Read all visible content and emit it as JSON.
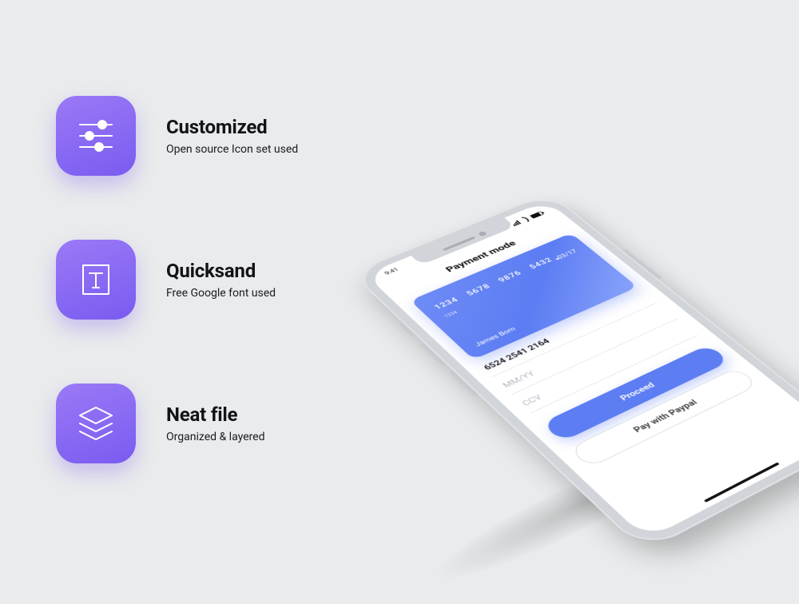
{
  "features": [
    {
      "title": "Customized",
      "subtitle": "Open source Icon set used",
      "icon": "sliders-icon"
    },
    {
      "title": "Quicksand",
      "subtitle": "Free Google font used",
      "icon": "typography-icon"
    },
    {
      "title": "Neat file",
      "subtitle": "Organized & layered",
      "icon": "layers-icon"
    }
  ],
  "phone": {
    "status": {
      "time": "9:41"
    },
    "app_title": "Payment mode",
    "card": {
      "number_groups": [
        "1234",
        "5678",
        "9876",
        "5432"
      ],
      "label": "1234",
      "holder": "James Born",
      "expiry": "03/17"
    },
    "fields": {
      "card_number_value": "6524 2541 2164",
      "expiry_placeholder": "MM/YY",
      "ccv_placeholder": "CCV"
    },
    "buttons": {
      "proceed": "Proceed",
      "paypal": "Pay with Paypal"
    }
  }
}
